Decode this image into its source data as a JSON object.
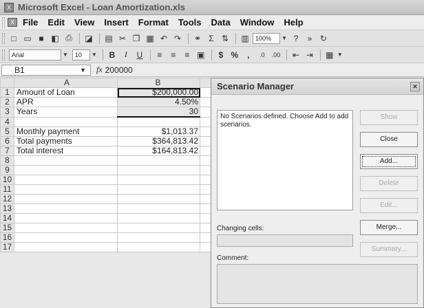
{
  "window": {
    "title": "Microsoft Excel - Loan Amortization.xls",
    "app_icon": "excel-icon"
  },
  "menubar": {
    "items": [
      "File",
      "Edit",
      "View",
      "Insert",
      "Format",
      "Tools",
      "Data",
      "Window",
      "Help"
    ]
  },
  "toolbar": {
    "zoom": "100%"
  },
  "format_toolbar": {
    "font": "Arial",
    "font_size": "10",
    "bold": "B",
    "italic": "I",
    "underline": "U",
    "currency": "$",
    "percent": "%",
    "comma": ","
  },
  "formula_bar": {
    "name_box": "B1",
    "fx": "fx",
    "value": "200000"
  },
  "sheet": {
    "columns": [
      "A",
      "B"
    ],
    "rows": [
      {
        "n": "1",
        "a": "Amount of Loan",
        "b": "$200,000.00"
      },
      {
        "n": "2",
        "a": "APR",
        "b": "4.50%"
      },
      {
        "n": "3",
        "a": "Years",
        "b": "30"
      },
      {
        "n": "4",
        "a": "",
        "b": ""
      },
      {
        "n": "5",
        "a": "Monthly payment",
        "b": "$1,013.37"
      },
      {
        "n": "6",
        "a": "Total payments",
        "b": "$364,813.42"
      },
      {
        "n": "7",
        "a": "Total interest",
        "b": "$164,813.42"
      },
      {
        "n": "8",
        "a": "",
        "b": ""
      },
      {
        "n": "9",
        "a": "",
        "b": ""
      },
      {
        "n": "10",
        "a": "",
        "b": ""
      },
      {
        "n": "11",
        "a": "",
        "b": ""
      },
      {
        "n": "12",
        "a": "",
        "b": ""
      },
      {
        "n": "13",
        "a": "",
        "b": ""
      },
      {
        "n": "14",
        "a": "",
        "b": ""
      },
      {
        "n": "15",
        "a": "",
        "b": ""
      },
      {
        "n": "16",
        "a": "",
        "b": ""
      },
      {
        "n": "17",
        "a": "",
        "b": ""
      }
    ]
  },
  "dialog": {
    "title": "Scenario Manager",
    "list_text": "No Scenarios defined. Choose Add to add scenarios.",
    "buttons": {
      "show": "Show",
      "close": "Close",
      "add": "Add...",
      "delete": "Delete",
      "edit": "Edit...",
      "merge": "Merge...",
      "summary": "Summary..."
    },
    "changing_cells_label": "Changing cells:",
    "comment_label": "Comment:"
  }
}
